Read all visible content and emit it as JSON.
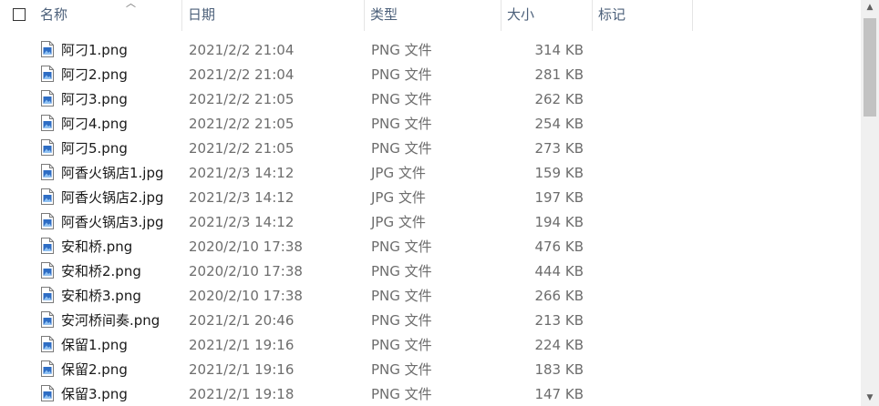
{
  "columns": {
    "name": "名称",
    "date": "日期",
    "type": "类型",
    "size": "大小",
    "tags": "标记"
  },
  "icons": {
    "sort": "chevron-up-icon",
    "file": "image-file-icon"
  },
  "colors": {
    "header_text": "#4c607a",
    "file_icon_blue": "#2e6dc4"
  },
  "files": [
    {
      "name": "阿刁1.png",
      "date": "2021/2/2 21:04",
      "type": "PNG 文件",
      "size": "314 KB"
    },
    {
      "name": "阿刁2.png",
      "date": "2021/2/2 21:04",
      "type": "PNG 文件",
      "size": "281 KB"
    },
    {
      "name": "阿刁3.png",
      "date": "2021/2/2 21:05",
      "type": "PNG 文件",
      "size": "262 KB"
    },
    {
      "name": "阿刁4.png",
      "date": "2021/2/2 21:05",
      "type": "PNG 文件",
      "size": "254 KB"
    },
    {
      "name": "阿刁5.png",
      "date": "2021/2/2 21:05",
      "type": "PNG 文件",
      "size": "273 KB"
    },
    {
      "name": "阿香火锅店1.jpg",
      "date": "2021/2/3 14:12",
      "type": "JPG 文件",
      "size": "159 KB"
    },
    {
      "name": "阿香火锅店2.jpg",
      "date": "2021/2/3 14:12",
      "type": "JPG 文件",
      "size": "197 KB"
    },
    {
      "name": "阿香火锅店3.jpg",
      "date": "2021/2/3 14:12",
      "type": "JPG 文件",
      "size": "194 KB"
    },
    {
      "name": "安和桥.png",
      "date": "2020/2/10 17:38",
      "type": "PNG 文件",
      "size": "476 KB"
    },
    {
      "name": "安和桥2.png",
      "date": "2020/2/10 17:38",
      "type": "PNG 文件",
      "size": "444 KB"
    },
    {
      "name": "安和桥3.png",
      "date": "2020/2/10 17:38",
      "type": "PNG 文件",
      "size": "266 KB"
    },
    {
      "name": "安河桥间奏.png",
      "date": "2021/2/1 20:46",
      "type": "PNG 文件",
      "size": "213 KB"
    },
    {
      "name": "保留1.png",
      "date": "2021/2/1 19:16",
      "type": "PNG 文件",
      "size": "224 KB"
    },
    {
      "name": "保留2.png",
      "date": "2021/2/1 19:16",
      "type": "PNG 文件",
      "size": "183 KB"
    },
    {
      "name": "保留3.png",
      "date": "2021/2/1 19:18",
      "type": "PNG 文件",
      "size": "147 KB"
    }
  ]
}
